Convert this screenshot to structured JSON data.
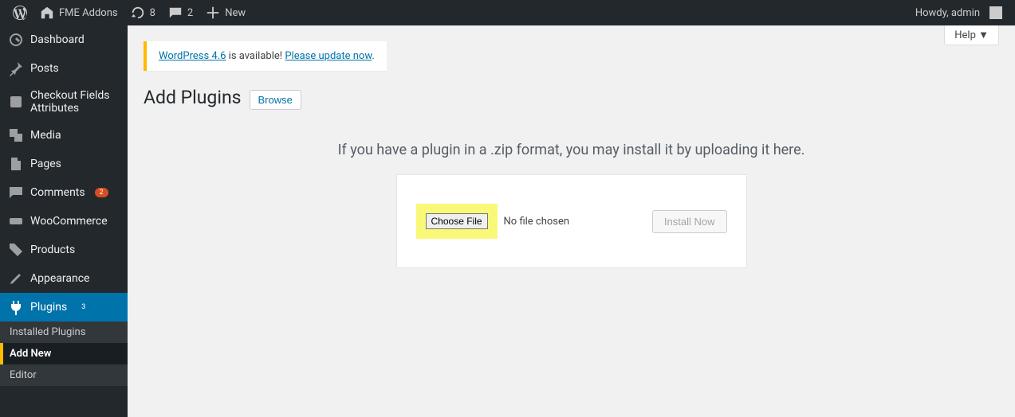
{
  "adminbar": {
    "site_title": "FME Addons",
    "updates_count": "8",
    "comments_count": "2",
    "new_label": "New",
    "howdy": "Howdy, admin"
  },
  "sidebar": {
    "dashboard": "Dashboard",
    "posts": "Posts",
    "checkout": "Checkout Fields Attributes",
    "media": "Media",
    "pages": "Pages",
    "comments": "Comments",
    "comments_count": "2",
    "woocommerce": "WooCommerce",
    "products": "Products",
    "appearance": "Appearance",
    "plugins": "Plugins",
    "plugins_count": "3",
    "submenu": {
      "installed": "Installed Plugins",
      "addnew": "Add New",
      "editor": "Editor"
    }
  },
  "content": {
    "help": "Help",
    "notice_prefix": "WordPress 4.6",
    "notice_mid_text": " is available! ",
    "notice_link": "Please update now",
    "notice_suffix": ".",
    "page_title": "Add Plugins",
    "browse": "Browse",
    "upload_desc": "If you have a plugin in a .zip format, you may install it by uploading it here.",
    "choose_file": "Choose File",
    "no_file": "No file chosen",
    "install_now": "Install Now"
  }
}
